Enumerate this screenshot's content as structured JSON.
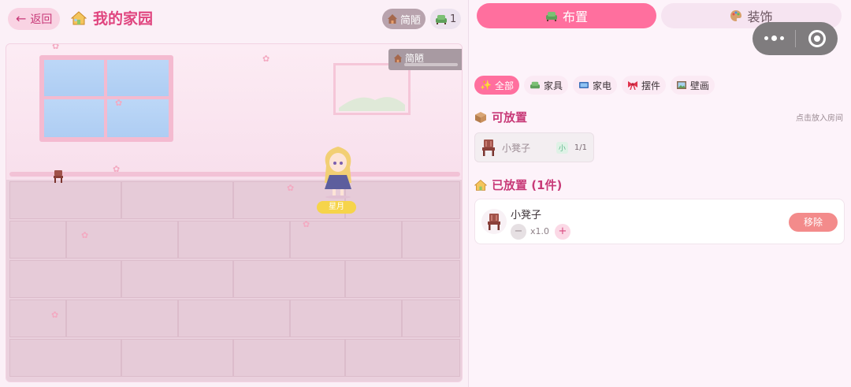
{
  "header": {
    "back_label": "返回",
    "title": "我的家园",
    "style_badge": "简陋",
    "furniture_count": "1"
  },
  "room": {
    "name_tag": "简陋",
    "character_name": "星月"
  },
  "tabs": [
    {
      "label": "布置",
      "icon": "sofa-icon",
      "active": true
    },
    {
      "label": "装饰",
      "icon": "palette-icon",
      "active": false
    }
  ],
  "filters": [
    {
      "label": "全部",
      "icon": "sparkle-icon",
      "active": true
    },
    {
      "label": "家具",
      "icon": "sofa-icon",
      "active": false
    },
    {
      "label": "家电",
      "icon": "tv-icon",
      "active": false
    },
    {
      "label": "摆件",
      "icon": "ribbon-icon",
      "active": false
    },
    {
      "label": "壁画",
      "icon": "picture-icon",
      "active": false
    }
  ],
  "available": {
    "title": "可放置",
    "hint": "点击放入房间",
    "items": [
      {
        "name": "小凳子",
        "size": "小",
        "qty": "1/1"
      }
    ]
  },
  "placed": {
    "title": "已放置 (1件)",
    "items": [
      {
        "name": "小凳子",
        "scale": "x1.0",
        "remove_label": "移除"
      }
    ]
  },
  "colors": {
    "accent": "#ff6f9e",
    "title_pink": "#e0457f",
    "remove_red": "#f38b8b"
  }
}
